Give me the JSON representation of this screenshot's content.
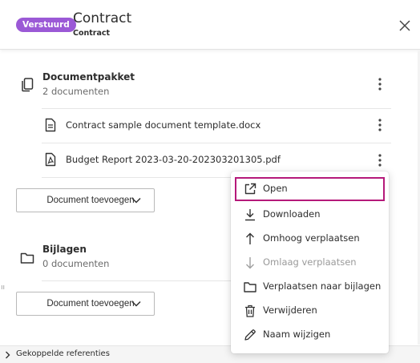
{
  "header": {
    "badge": "Verstuurd",
    "title": "Contract",
    "subtitle": "Contract",
    "badge_color": "#9b59d6"
  },
  "package": {
    "title": "Documentpakket",
    "count": "2 documenten",
    "files": [
      {
        "name": "Contract sample document template.docx",
        "icon": "document-icon"
      },
      {
        "name": "Budget Report 2023-03-20-202303201305.pdf",
        "icon": "pdf-icon"
      }
    ],
    "add_button": "Document toevoegen"
  },
  "attachments": {
    "title": "Bijlagen",
    "count": "0 documenten",
    "add_button": "Document toevoegen"
  },
  "footer": {
    "label": "Gekoppelde referenties"
  },
  "context_menu": {
    "highlight_color": "#b5197a",
    "items": [
      {
        "label": "Open",
        "icon": "external-link-icon",
        "disabled": false,
        "highlighted": true
      },
      {
        "label": "Downloaden",
        "icon": "download-icon",
        "disabled": false
      },
      {
        "label": "Omhoog verplaatsen",
        "icon": "arrow-up-icon",
        "disabled": false
      },
      {
        "label": "Omlaag verplaatsen",
        "icon": "arrow-down-icon",
        "disabled": true
      },
      {
        "label": "Verplaatsen naar bijlagen",
        "icon": "folder-icon",
        "disabled": false
      },
      {
        "label": "Verwijderen",
        "icon": "trash-icon",
        "disabled": false
      },
      {
        "label": "Naam wijzigen",
        "icon": "pencil-icon",
        "disabled": false
      }
    ]
  }
}
